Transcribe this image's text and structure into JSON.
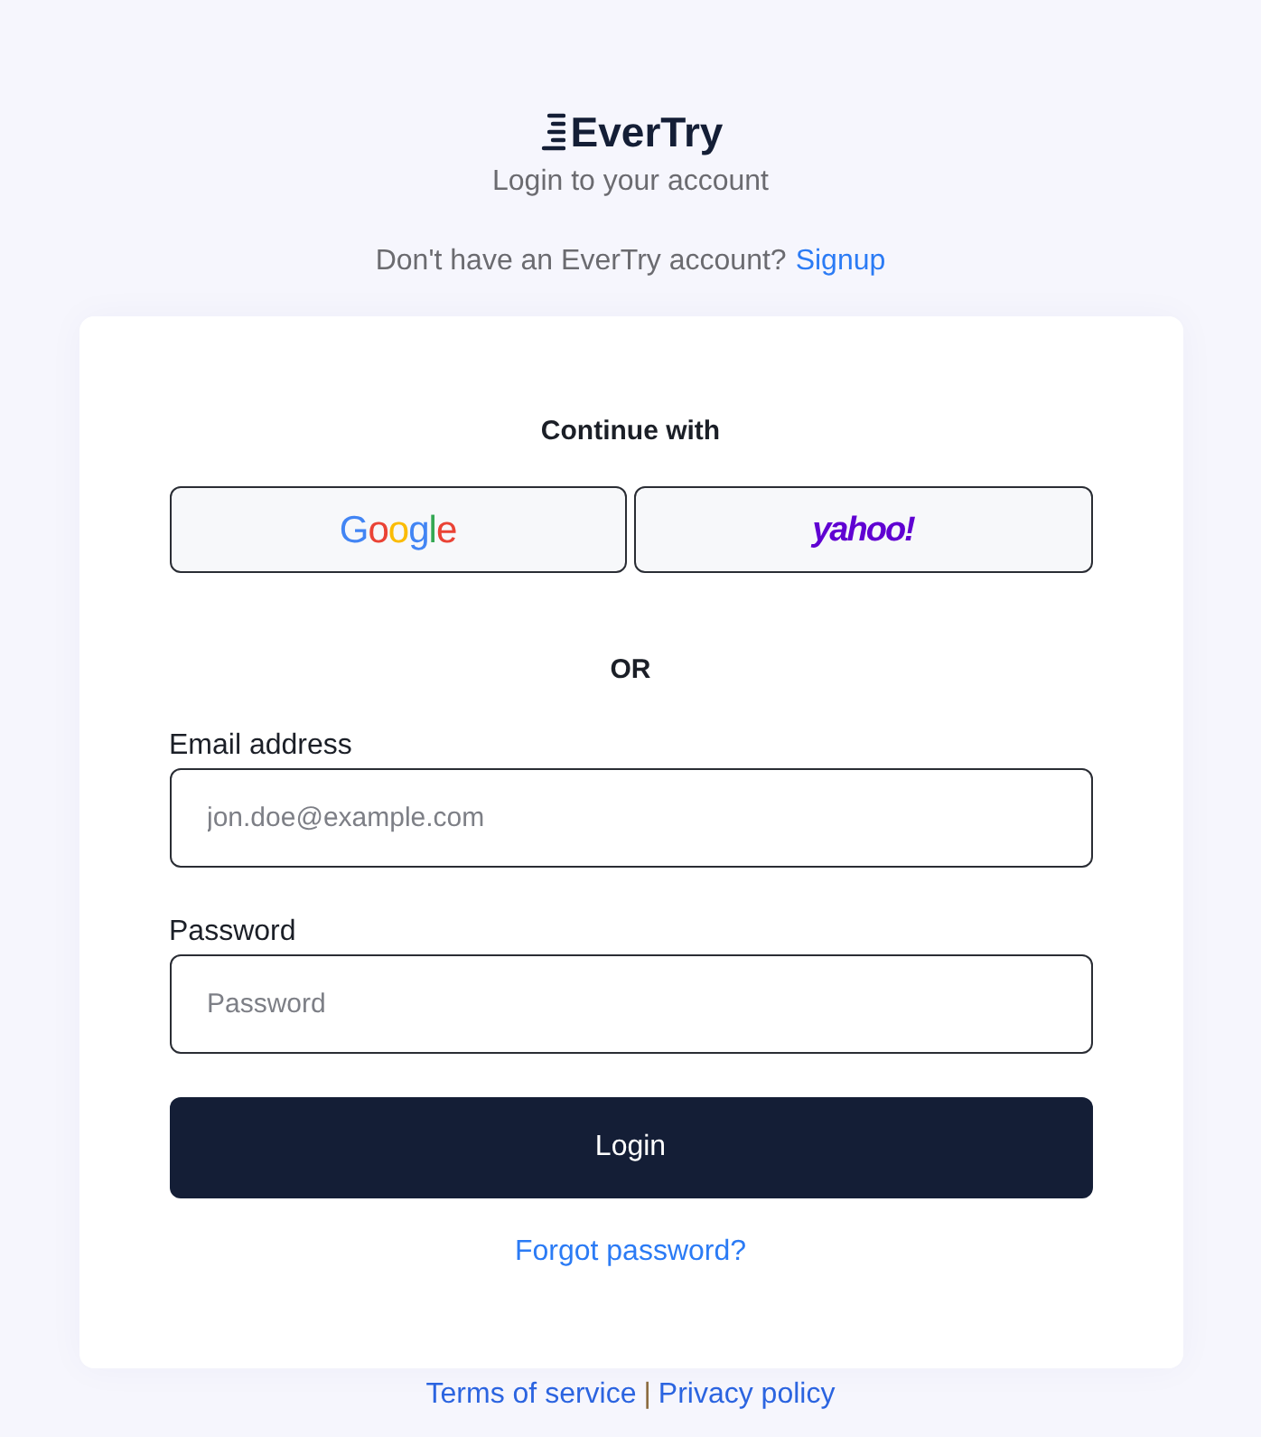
{
  "brand": {
    "name": "EverTry"
  },
  "subtitle": "Login to your account",
  "signup_prompt": {
    "text": "Don't have an EverTry account?",
    "link": "Signup"
  },
  "card": {
    "continue_label": "Continue with",
    "providers": [
      {
        "kind": "google",
        "label": "Google"
      },
      {
        "kind": "yahoo",
        "label": "yahoo!"
      }
    ],
    "divider": "OR",
    "fields": [
      {
        "label": "Email address",
        "placeholder": "jon.doe@example.com"
      },
      {
        "label": "Password",
        "placeholder": "Password"
      }
    ],
    "submit": "Login",
    "forgot_link": "Forgot password?"
  },
  "footer": {
    "links": [
      "Terms of service",
      "Privacy policy"
    ],
    "separator": "|"
  }
}
